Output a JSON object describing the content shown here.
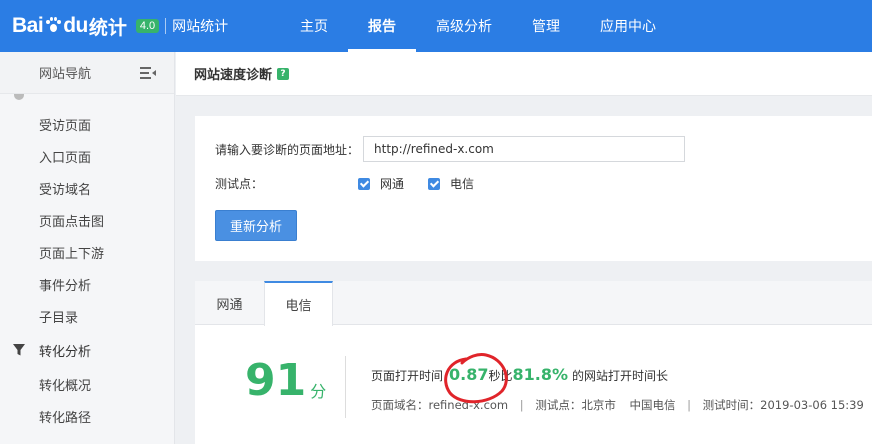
{
  "brand": {
    "logo_left": "Bai",
    "logo_right": "du",
    "name": "统计",
    "version": "4.0",
    "subtitle": "网站统计"
  },
  "nav": [
    {
      "label": "主页"
    },
    {
      "label": "报告"
    },
    {
      "label": "高级分析"
    },
    {
      "label": "管理"
    },
    {
      "label": "应用中心"
    }
  ],
  "sidebar": {
    "title": "网站导航",
    "items": [
      "受访页面",
      "入口页面",
      "受访域名",
      "页面点击图",
      "页面上下游",
      "事件分析",
      "子目录"
    ],
    "group": "转化分析",
    "group_items": [
      "转化概况",
      "转化路径"
    ]
  },
  "page": {
    "title": "网站速度诊断",
    "help": "?"
  },
  "form": {
    "url_label": "请输入要诊断的页面地址：",
    "url_value": "http://refined-x.com",
    "points_label": "测试点：",
    "options": [
      {
        "label": "网通",
        "checked": true
      },
      {
        "label": "电信",
        "checked": true
      }
    ],
    "reanalyze_button": "重新分析"
  },
  "result": {
    "tabs": [
      "网通",
      "电信"
    ],
    "active_tab": "电信",
    "score": "91",
    "score_unit": "分",
    "open_time_label": "页面打开时间",
    "open_time_value": "0.87",
    "seconds_label": "秒",
    "compare_label": "比",
    "compare_value": "81.8%",
    "compare_suffix": "的网站打开时间长",
    "domain_label": "页面域名：",
    "domain_value": "refined-x.com",
    "point_label": "测试点：",
    "point_city": "北京市",
    "point_isp": "中国电信",
    "test_time_label": "测试时间：",
    "test_time_value": "2019-03-06 15:39"
  },
  "colors": {
    "topbar": "#2b7de4",
    "accent": "#37b36b",
    "button": "#4a90e2",
    "annotation": "#e0242a"
  }
}
